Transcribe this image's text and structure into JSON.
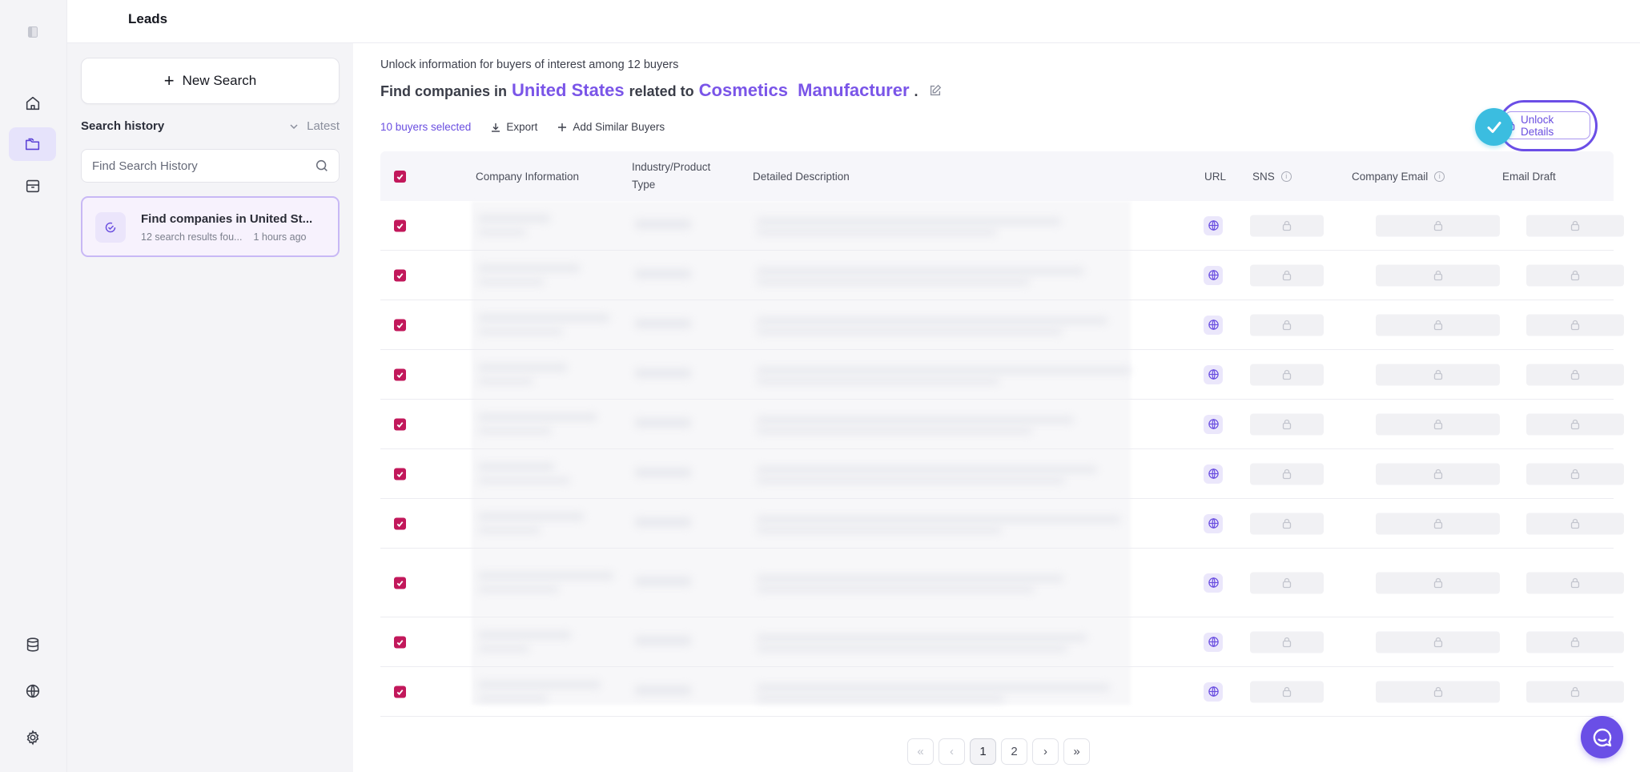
{
  "page_title": "Leads",
  "new_search_label": "New Search",
  "history": {
    "label": "Search history",
    "sort_label": "Latest",
    "search_placeholder": "Find Search History",
    "item": {
      "title": "Find companies in United St...",
      "results": "12 search results fou...",
      "time": "1 hours ago"
    }
  },
  "main": {
    "subtitle": "Unlock information for buyers of interest among 12 buyers",
    "headline": {
      "prefix": "Find companies in",
      "country": "United States",
      "middle": "related to",
      "industry": "Cosmetics  Manufacturer",
      "suffix": "."
    },
    "selected_label": "10 buyers selected",
    "export_label": "Export",
    "add_similar_label": "Add Similar Buyers",
    "unlock_label": "Unlock Details"
  },
  "table": {
    "columns": {
      "company": "Company Information",
      "industry": "Industry/Product Type",
      "description": "Detailed Description",
      "url": "URL",
      "sns": "SNS",
      "email": "Company Email",
      "draft": "Email Draft"
    },
    "rows": [
      {
        "checked": true
      },
      {
        "checked": true
      },
      {
        "checked": true
      },
      {
        "checked": true
      },
      {
        "checked": true
      },
      {
        "checked": true
      },
      {
        "checked": true
      },
      {
        "checked": true
      },
      {
        "checked": true
      },
      {
        "checked": true
      }
    ]
  },
  "pagination": {
    "first": "«",
    "prev": "‹",
    "pages": [
      "1",
      "2"
    ],
    "next": "›",
    "last": "»",
    "current": "1"
  },
  "colors": {
    "accent": "#7a55e8",
    "checkbox": "#c2185b",
    "cyan": "#3bbde0"
  }
}
